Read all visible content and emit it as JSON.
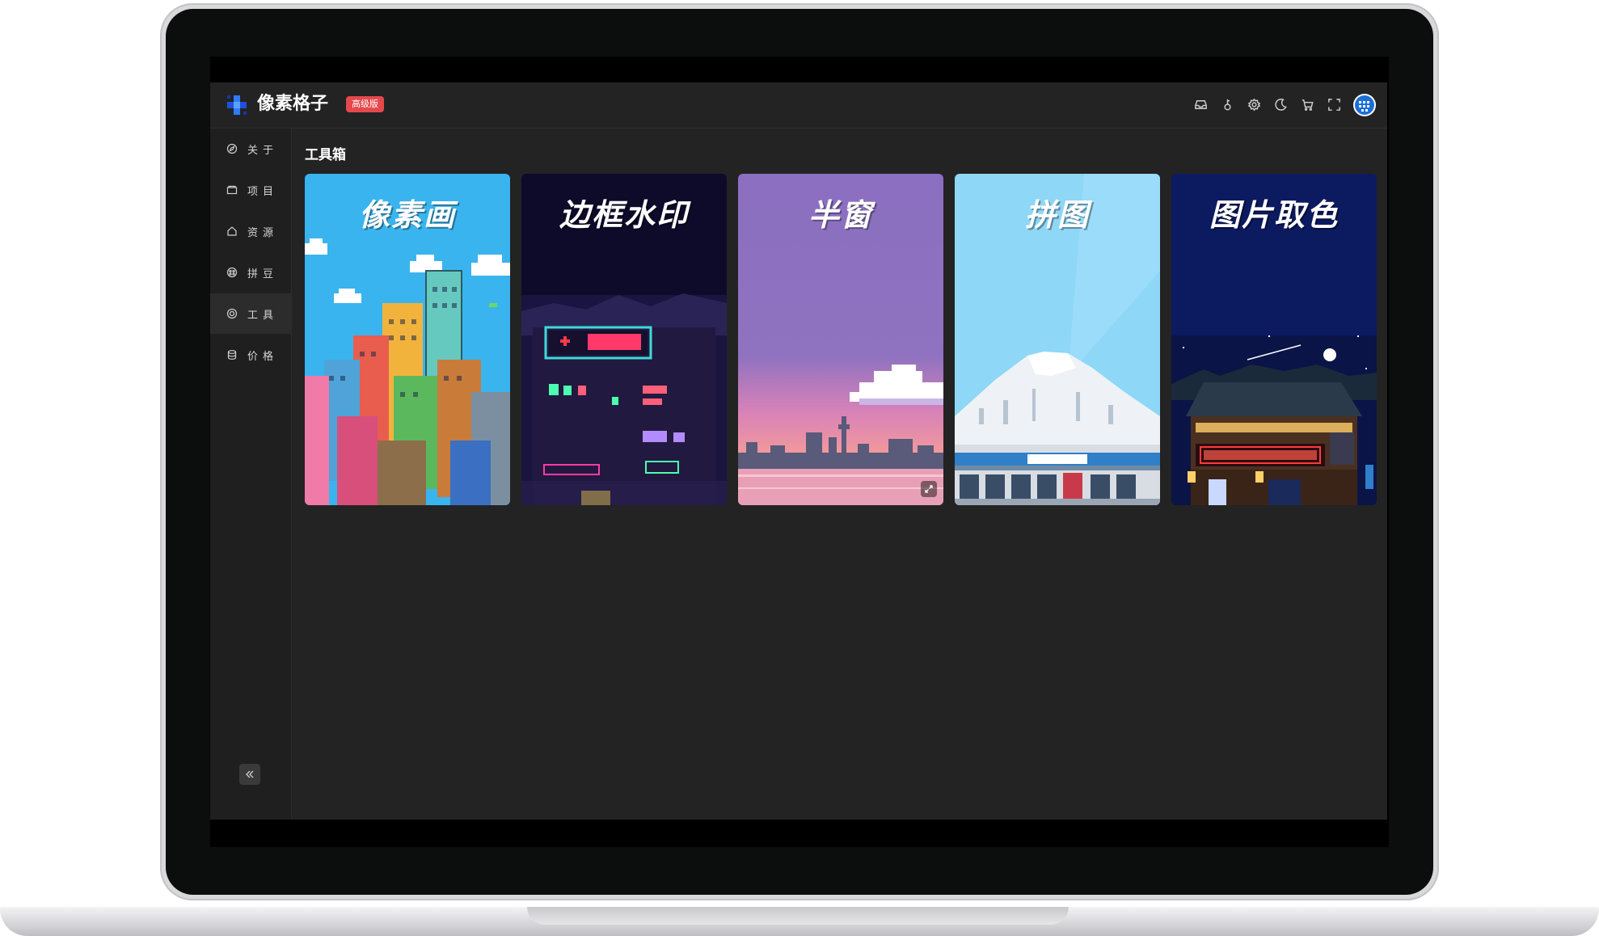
{
  "app": {
    "title": "像素格子",
    "badge": "高级版"
  },
  "header_icons": [
    "inbox-icon",
    "key-icon",
    "gear-icon",
    "moon-icon",
    "cart-icon",
    "fullscreen-icon"
  ],
  "sidebar": {
    "items": [
      {
        "label": "关于",
        "icon": "compass-icon"
      },
      {
        "label": "项目",
        "icon": "folder-icon"
      },
      {
        "label": "资源",
        "icon": "home-icon"
      },
      {
        "label": "拼豆",
        "icon": "bead-icon"
      },
      {
        "label": "工具",
        "icon": "tool-icon",
        "active": true
      },
      {
        "label": "价格",
        "icon": "database-icon"
      }
    ],
    "collapse_icon": "double-chevron-left-icon"
  },
  "main": {
    "section_title": "工具箱",
    "tools": [
      {
        "label": "像素画",
        "color": "#3ab4ee"
      },
      {
        "label": "边框水印",
        "color": "#0e0a2a"
      },
      {
        "label": "半窗",
        "color": "#8c72c0"
      },
      {
        "label": "拼图",
        "color": "#8ed7f7"
      },
      {
        "label": "图片取色",
        "color": "#0c1a60"
      }
    ]
  },
  "colors": {
    "accent_badge": "#e5484d",
    "bg_dark": "#232323"
  }
}
